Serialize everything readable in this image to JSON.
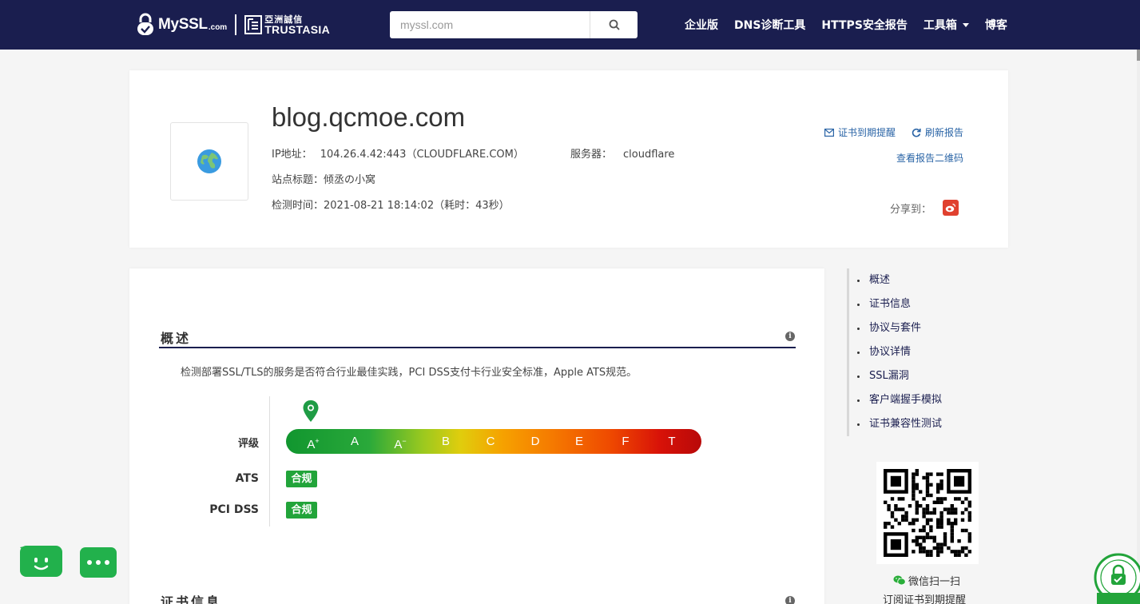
{
  "nav": {
    "logo_myssl": "MySSL",
    "logo_com": ".com",
    "logo_ta_cn": "亞洲誠信",
    "logo_ta_en": "TRUSTASIA",
    "search_placeholder": "myssl.com",
    "links": [
      "企业版",
      "DNS诊断工具",
      "HTTPS安全报告",
      "工具箱",
      "博客"
    ]
  },
  "report": {
    "host": "blog.qcmoe.com",
    "ip_label": "IP地址：",
    "ip_value": "104.26.4.42:443（CLOUDFLARE.COM）",
    "server_label": "服务器：",
    "server_value": "cloudflare",
    "title_label": "站点标题：",
    "title_value": "倾丞の小窝",
    "time_label": "检测时间：",
    "time_value": "2021-08-21 18:14:02（耗时：43秒）",
    "cert_reminder": "证书到期提醒",
    "refresh": "刷新报告",
    "qr_link": "查看报告二维码",
    "share_label": "分享到："
  },
  "overview": {
    "title": "概述",
    "description": "检测部署SSL/TLS的服务是否符合行业最佳实践，PCI DSS支付卡行业安全标准，Apple ATS规范。",
    "grade_label": "评级",
    "grades": [
      "A+",
      "A",
      "A-",
      "B",
      "C",
      "D",
      "E",
      "F",
      "T"
    ],
    "current_grade": "A+",
    "ats_label": "ATS",
    "ats_status": "合规",
    "pci_label": "PCI DSS",
    "pci_status": "合规",
    "next_section_title": "证书信息"
  },
  "sidebar": {
    "items": [
      "概述",
      "证书信息",
      "协议与套件",
      "协议详情",
      "SSL漏洞",
      "客户端握手模拟",
      "证书兼容性测试"
    ],
    "wechat_scan": "微信扫一扫",
    "subscribe": "订阅证书到期提醒"
  },
  "colors": {
    "nav_bg": "#1a1e4f",
    "link": "#2a64a6",
    "ok_green": "#22a43a",
    "weibo_red": "#e0412f"
  }
}
